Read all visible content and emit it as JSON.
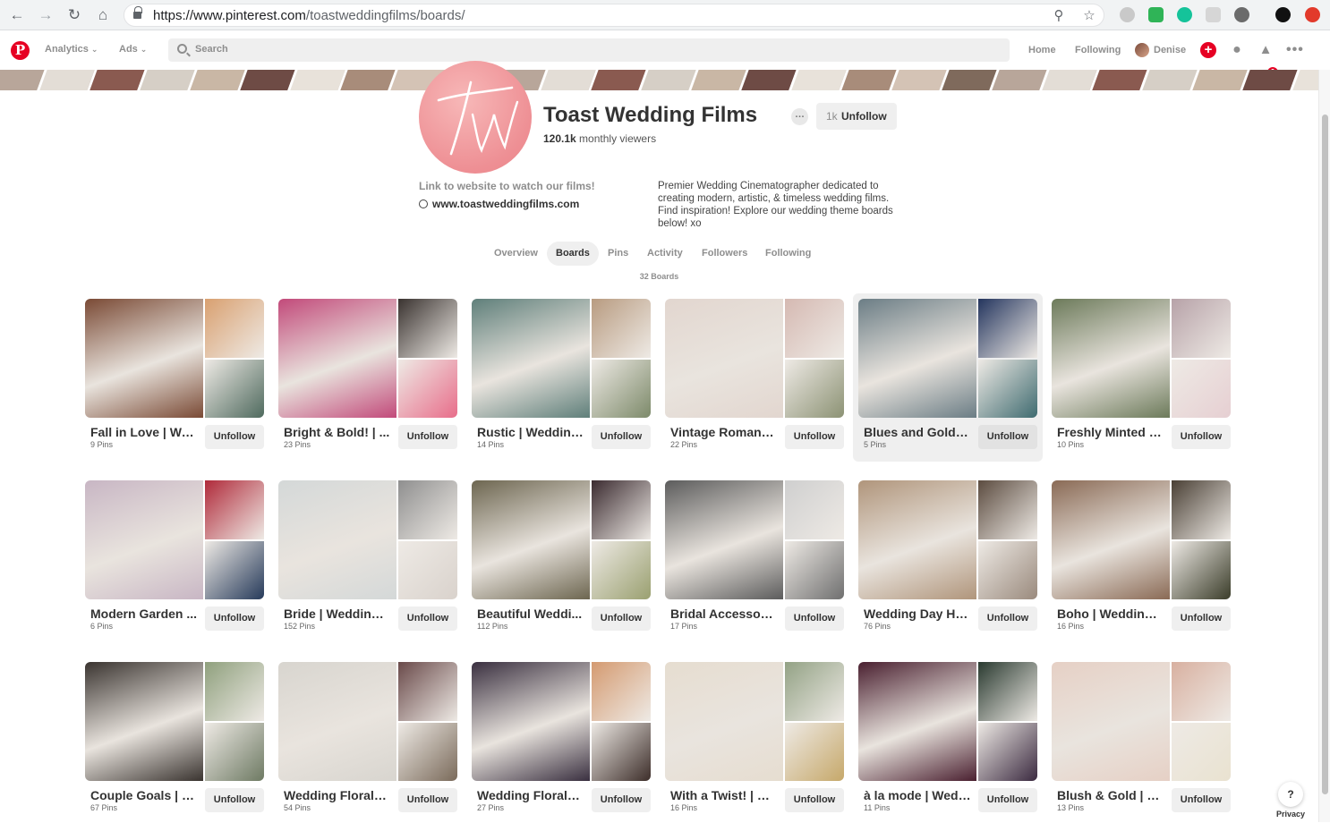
{
  "browser": {
    "url_host": "https://www.pinterest.com",
    "url_path": "/toastweddingfilms/boards/"
  },
  "header": {
    "analytics_label": "Analytics",
    "ads_label": "Ads",
    "search_placeholder": "Search",
    "home_label": "Home",
    "following_label": "Following",
    "user_name": "Denise",
    "notification_count": "2"
  },
  "profile": {
    "name": "Toast Wedding Films",
    "monthly_viewers": "120.1k",
    "monthly_viewers_label": "monthly viewers",
    "follow_count": "1k",
    "follow_button_label": "Unfollow",
    "website_prompt": "Link to website to watch our films!",
    "website": "www.toastweddingfilms.com",
    "bio": "Premier Wedding Cinematographer dedicated to creating modern, artistic, & timeless wedding films. Find inspiration! Explore our wedding theme boards below! xo"
  },
  "tabs": [
    {
      "label": "Overview",
      "active": false
    },
    {
      "label": "Boards",
      "active": true
    },
    {
      "label": "Pins",
      "active": false
    },
    {
      "label": "Activity",
      "active": false
    },
    {
      "label": "Followers",
      "active": false
    },
    {
      "label": "Following",
      "active": false
    }
  ],
  "board_count_label": "32 Boards",
  "unfollow_label": "Unfollow",
  "boards": [
    {
      "title": "Fall in Love | We...",
      "pins": "9 Pins",
      "colors": [
        "#7a4a35",
        "#d9a070",
        "#4f6a5e"
      ]
    },
    {
      "title": "Bright & Bold! | ...",
      "pins": "23 Pins",
      "colors": [
        "#c24a7a",
        "#3a3330",
        "#e86d8a"
      ]
    },
    {
      "title": "Rustic | Wedding...",
      "pins": "14 Pins",
      "colors": [
        "#5f7f7a",
        "#b89b80",
        "#7d8a6a"
      ]
    },
    {
      "title": "Vintage Romanc...",
      "pins": "22 Pins",
      "colors": [
        "#e2d6cf",
        "#d5b9b2",
        "#8c9274"
      ]
    },
    {
      "title": "Blues and Golds ...",
      "pins": "5 Pins",
      "colors": [
        "#6b7d85",
        "#24355e",
        "#3f6b70"
      ]
    },
    {
      "title": "Freshly Minted | ...",
      "pins": "10 Pins",
      "colors": [
        "#6c7a5a",
        "#b7a2a8",
        "#e6cfd2"
      ]
    },
    {
      "title": "Modern Garden ...",
      "pins": "6 Pins",
      "colors": [
        "#c8b6c4",
        "#b02a3a",
        "#263a5a"
      ]
    },
    {
      "title": "Bride | Wedding ...",
      "pins": "152 Pins",
      "colors": [
        "#d4d8d8",
        "#8f8f8f",
        "#d9d2cc"
      ]
    },
    {
      "title": "Beautiful Weddi...",
      "pins": "112 Pins",
      "colors": [
        "#6d6650",
        "#3b2b30",
        "#9aa070"
      ]
    },
    {
      "title": "Bridal Accessori...",
      "pins": "17 Pins",
      "colors": [
        "#5c5c5c",
        "#cfcfcf",
        "#6f6f6f"
      ]
    },
    {
      "title": "Wedding Day Ha...",
      "pins": "76 Pins",
      "colors": [
        "#b0957b",
        "#5c4c40",
        "#9a8a7d"
      ]
    },
    {
      "title": "Boho | Wedding ...",
      "pins": "16 Pins",
      "colors": [
        "#8a6a55",
        "#4a4035",
        "#3b3d2a"
      ]
    },
    {
      "title": "Couple Goals | x...",
      "pins": "67 Pins",
      "colors": [
        "#3a3430",
        "#8fa07d",
        "#6e7a63"
      ]
    },
    {
      "title": "Wedding Florals ...",
      "pins": "54 Pins",
      "colors": [
        "#d8d5cf",
        "#6a4a4a",
        "#7a6a5a"
      ]
    },
    {
      "title": "Wedding Florals ...",
      "pins": "27 Pins",
      "colors": [
        "#3a3040",
        "#d49a70",
        "#3d2e2a"
      ]
    },
    {
      "title": "With a Twist! | W...",
      "pins": "16 Pins",
      "colors": [
        "#e6ddd0",
        "#93a285",
        "#c6a86a"
      ]
    },
    {
      "title": "à la mode | Wedd...",
      "pins": "11 Pins",
      "colors": [
        "#4a2030",
        "#2a3a30",
        "#3b2a40"
      ]
    },
    {
      "title": "Blush & Gold | W...",
      "pins": "13 Pins",
      "colors": [
        "#e6d0c5",
        "#d8b0a0",
        "#e9e2d0"
      ]
    }
  ],
  "help_label": "?",
  "privacy_label": "Privacy"
}
